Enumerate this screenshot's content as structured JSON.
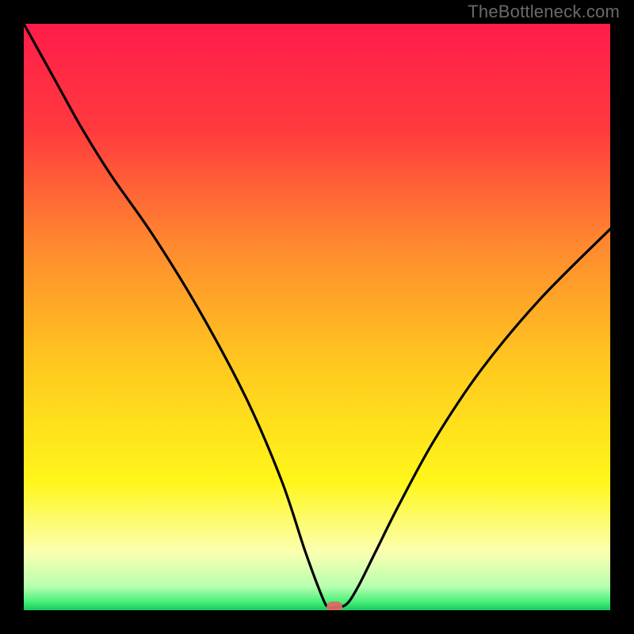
{
  "watermark": "TheBottleneck.com",
  "chart_data": {
    "type": "line",
    "title": "",
    "xlabel": "",
    "ylabel": "",
    "xlim": [
      0,
      100
    ],
    "ylim": [
      0,
      100
    ],
    "series": [
      {
        "name": "bottleneck-curve",
        "x": [
          0,
          5,
          10,
          15,
          22,
          30,
          38,
          44,
          48,
          51,
          52,
          53,
          55,
          57,
          60,
          64,
          70,
          78,
          88,
          100
        ],
        "y": [
          100,
          91,
          82,
          74,
          64,
          51,
          36,
          22,
          10,
          2,
          0.5,
          0.5,
          1,
          4,
          10,
          18,
          29,
          41,
          53,
          65
        ]
      }
    ],
    "marker": {
      "x": 53,
      "y": 0.5,
      "color": "#d96b66"
    },
    "gradient_stops": [
      {
        "offset": 0,
        "color": "#ff1d4a"
      },
      {
        "offset": 0.18,
        "color": "#ff3a3e"
      },
      {
        "offset": 0.38,
        "color": "#ff8a2f"
      },
      {
        "offset": 0.58,
        "color": "#ffc81f"
      },
      {
        "offset": 0.78,
        "color": "#fff61a"
      },
      {
        "offset": 0.9,
        "color": "#fcffb0"
      },
      {
        "offset": 0.96,
        "color": "#b7ffb0"
      },
      {
        "offset": 0.985,
        "color": "#4bf07a"
      },
      {
        "offset": 1.0,
        "color": "#18c95e"
      }
    ]
  }
}
